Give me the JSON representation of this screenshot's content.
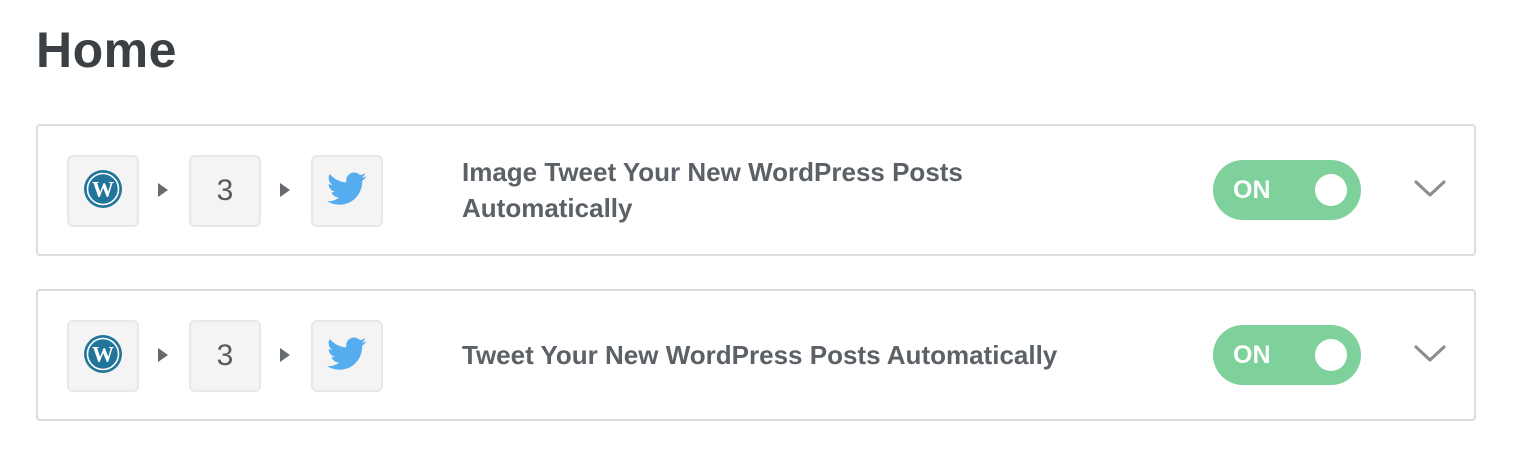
{
  "page": {
    "title": "Home"
  },
  "colors": {
    "toggle_on": "#7ed19a",
    "card_border": "#dddddd",
    "step_bg": "#f4f4f4",
    "wordpress_blue": "#21759b",
    "twitter_blue": "#55acee"
  },
  "zaps": [
    {
      "trigger_icon": "wordpress-icon",
      "step_count": "3",
      "action_icon": "twitter-icon",
      "title": "Image Tweet Your New WordPress Posts Automatically",
      "toggle_label": "ON",
      "toggle_on": true,
      "expand_icon": "chevron-down-icon"
    },
    {
      "trigger_icon": "wordpress-icon",
      "step_count": "3",
      "action_icon": "twitter-icon",
      "title": "Tweet Your New WordPress Posts Automatically",
      "toggle_label": "ON",
      "toggle_on": true,
      "expand_icon": "chevron-down-icon"
    }
  ]
}
